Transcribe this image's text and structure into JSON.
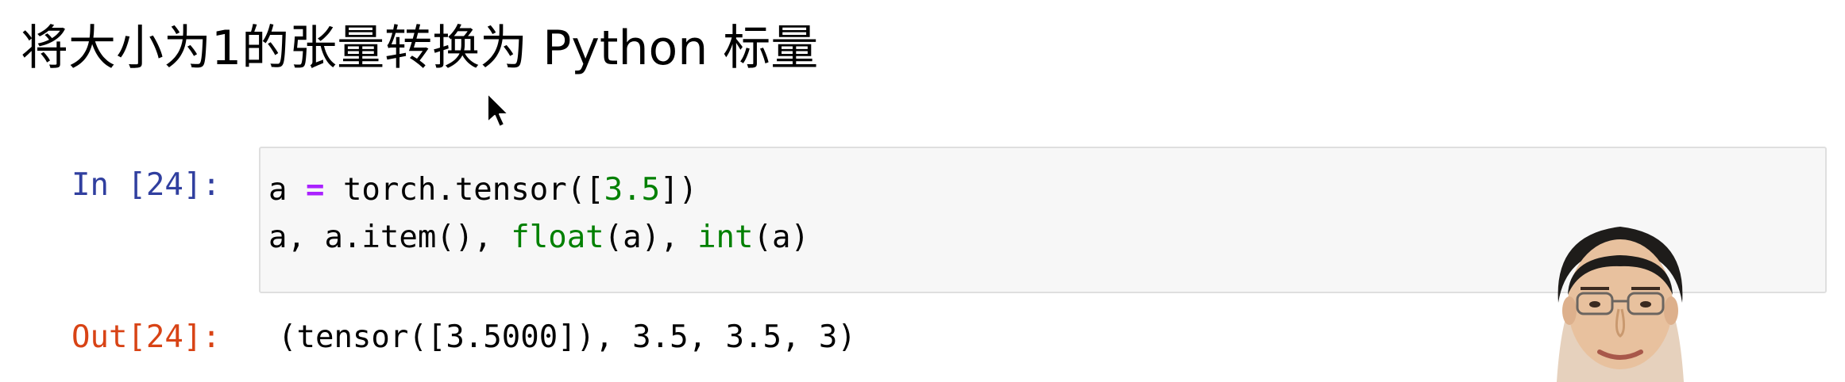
{
  "heading": "将大小为1的张量转换为 Python 标量",
  "cell": {
    "in_prompt": "In [24]:",
    "out_prompt": "Out[24]:",
    "code": {
      "line1": {
        "var": "a",
        "assign": "=",
        "call_open": "torch.tensor([",
        "num": "3.5",
        "call_close": "])"
      },
      "line2": {
        "part1": "a, a.item(), ",
        "builtin1": "float",
        "part2": "(a), ",
        "builtin2": "int",
        "part3": "(a)"
      }
    },
    "output": "(tensor([3.5000]), 3.5, 3.5, 3)"
  },
  "icons": {
    "cursor": "mouse-pointer-icon"
  },
  "colors": {
    "in_prompt": "#303f9f",
    "out_prompt": "#d84315",
    "cell_background": "#f7f7f7",
    "cell_border": "#dfdfdf",
    "operator": "#aa22ff",
    "number": "#008000",
    "builtin": "#008000"
  }
}
